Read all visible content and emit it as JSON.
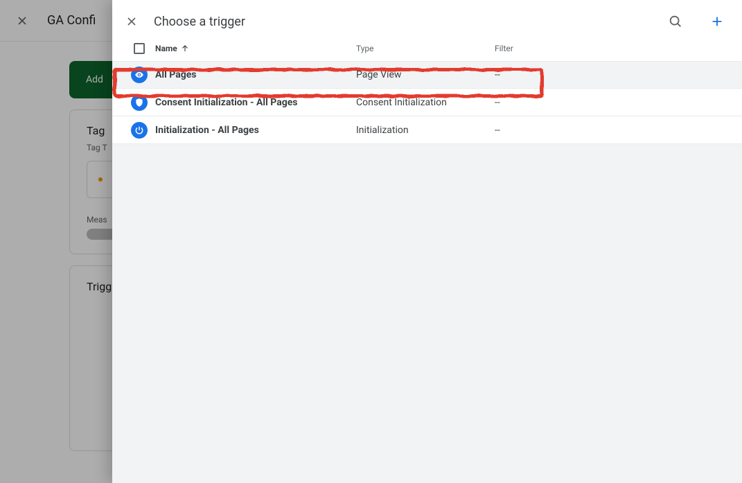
{
  "background": {
    "title_partial": "GA Confi",
    "add_banner_label": "Add",
    "tag_card_title_partial": "Tag",
    "tag_card_subtitle_partial": "Tag T",
    "measure_label_partial": "Meas",
    "trigger_card_title_partial": "Trigg"
  },
  "panel": {
    "title": "Choose a trigger",
    "columns": {
      "name": "Name",
      "type": "Type",
      "filter": "Filter"
    },
    "triggers": [
      {
        "icon": "eye",
        "name": "All Pages",
        "type": "Page View",
        "filter": "--",
        "highlighted": true
      },
      {
        "icon": "shield",
        "name": "Consent Initialization - All Pages",
        "type": "Consent Initialization",
        "filter": "--",
        "highlighted": false
      },
      {
        "icon": "power",
        "name": "Initialization - All Pages",
        "type": "Initialization",
        "filter": "--",
        "highlighted": false
      }
    ]
  }
}
